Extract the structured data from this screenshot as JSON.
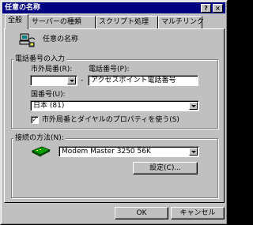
{
  "window": {
    "title": "任意の名称",
    "help_label": "?",
    "close_label": "×"
  },
  "tabs": [
    {
      "label": "全般"
    },
    {
      "label": "サーバーの種類"
    },
    {
      "label": "スクリプト処理"
    },
    {
      "label": "マルチリンク"
    }
  ],
  "connection": {
    "name": "任意の名称",
    "icon": "dial-up-connection-icon"
  },
  "phone": {
    "group_label": "電話番号の入力",
    "area_code_label": "市外局番(R):",
    "area_code_value": "",
    "dash": "-",
    "number_label": "電話番号(P):",
    "number_value": "アクセスポイント電話番号",
    "country_label": "国番号(U):",
    "country_value": "日本 (81)",
    "use_rules_label": "市外局番とダイヤルのプロパティを使う(S)",
    "use_rules_checked": true,
    "check_mark": "✓"
  },
  "connect_using": {
    "group_label": "接続の方法(N):",
    "modem_value": "Modem Master 3250 56K",
    "modem_icon": "modem-icon",
    "configure_label": "設定(C)..."
  },
  "footer": {
    "ok_label": "OK",
    "cancel_label": "キャンセル"
  }
}
